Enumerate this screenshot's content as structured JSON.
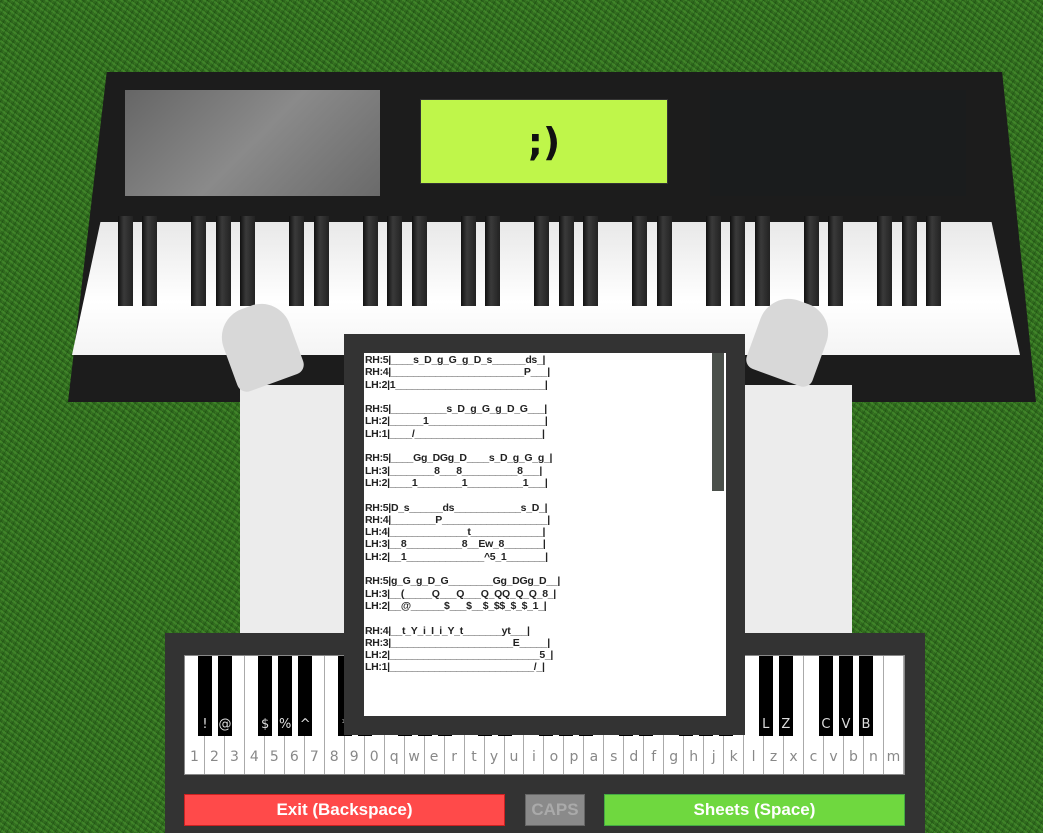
{
  "piano3d": {
    "screen_text": ";)",
    "screen_color": "#bff64a"
  },
  "sheet": {
    "lines": [
      "RH:5|____s_D_g_G_g_D_s______ds_|",
      "RH:4|________________________P___|",
      "LH:2|1___________________________|",
      "",
      "RH:5|__________s_D_g_G_g_D_G___|",
      "LH:2|______1_____________________|",
      "LH:1|____/_______________________|",
      "",
      "RH:5|____Gg_DGg_D____s_D_g_G_g_|",
      "LH:3|________8___8__________8___|",
      "LH:2|____1________1__________1___|",
      "",
      "RH:5|D_s______ds____________s_D_|",
      "RH:4|________P___________________|",
      "LH:4|______________t_____________|",
      "LH:3|__8__________8__Ew_8_______|",
      "LH:2|__1______________^5_1_______|",
      "",
      "RH:5|g_G_g_D_G________Gg_DGg_D__|",
      "LH:3|__(_____Q___Q___Q_QQ_Q_Q_8_|",
      "LH:2|__@______$___$__$_$$_$_$_1_|",
      "",
      "RH:4|__t_Y_i_I_i_Y_t_______yt___|",
      "RH:3|______________________E_____|",
      "LH:2|___________________________5_|",
      "LH:1|__________________________/_|"
    ],
    "scroll_fraction": 0.0
  },
  "keyboard": {
    "white_keys": [
      "1",
      "2",
      "3",
      "4",
      "5",
      "6",
      "7",
      "8",
      "9",
      "0",
      "q",
      "w",
      "e",
      "r",
      "t",
      "y",
      "u",
      "i",
      "o",
      "p",
      "a",
      "s",
      "d",
      "f",
      "g",
      "h",
      "j",
      "k",
      "l",
      "z",
      "x",
      "c",
      "v",
      "b",
      "n",
      "m"
    ],
    "black_keys": [
      [
        "1",
        "!"
      ],
      [
        "2",
        "@"
      ],
      [
        "4",
        "$"
      ],
      [
        "5",
        "%"
      ],
      [
        "6",
        "^"
      ],
      [
        "8",
        "*"
      ],
      [
        "9",
        "("
      ],
      [
        "q",
        "Q"
      ],
      [
        "w",
        "W"
      ],
      [
        "e",
        "E"
      ],
      [
        "t",
        "T"
      ],
      [
        "y",
        "Y"
      ],
      [
        "i",
        "I"
      ],
      [
        "o",
        "O"
      ],
      [
        "p",
        "P"
      ],
      [
        "s",
        "S"
      ],
      [
        "d",
        "D"
      ],
      [
        "g",
        "G"
      ],
      [
        "h",
        "H"
      ],
      [
        "j",
        "J"
      ],
      [
        "l",
        "L"
      ],
      [
        "z",
        "Z"
      ],
      [
        "c",
        "C"
      ],
      [
        "v",
        "V"
      ],
      [
        "b",
        "B"
      ]
    ]
  },
  "buttons": {
    "exit": "Exit (Backspace)",
    "caps": "CAPS",
    "sheets": "Sheets (Space)"
  },
  "colors": {
    "exit": "#ff4a4a",
    "sheets": "#6fd83f",
    "caps": "#8a8a8a"
  }
}
